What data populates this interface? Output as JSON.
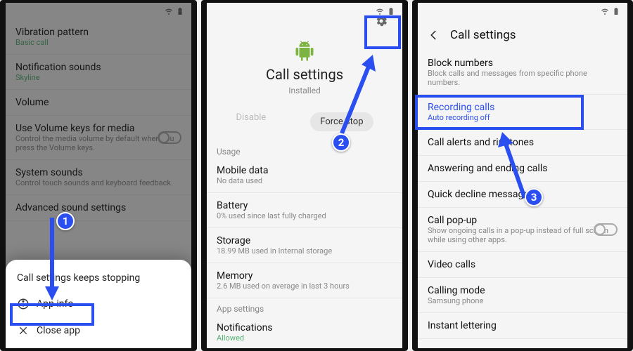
{
  "colors": {
    "highlight": "#2b4ef0"
  },
  "panel1": {
    "items": [
      {
        "title": "Vibration pattern",
        "sub": "Basic call",
        "subClass": "sub"
      },
      {
        "title": "Notification sounds",
        "sub": "Skyline",
        "subClass": "sub"
      },
      {
        "title": "Volume",
        "sub": "",
        "subClass": ""
      },
      {
        "title": "Use Volume keys for media",
        "sub": "Control the media volume by default when you press the Volume keys.",
        "subClass": "sub-gray",
        "toggle": true
      },
      {
        "title": "System sounds",
        "sub": "Control touch sounds and keyboard feedback.",
        "subClass": "sub-gray"
      },
      {
        "title": "Advanced sound settings",
        "sub": "",
        "subClass": ""
      }
    ],
    "dialog": {
      "heading": "Call settings keeps stopping",
      "actions": [
        {
          "icon": "info",
          "label": "App info"
        },
        {
          "icon": "close",
          "label": "Close app"
        }
      ]
    },
    "badge": "1"
  },
  "panel2": {
    "gear_icon": "settings",
    "app_name": "Call settings",
    "installed": "Installed",
    "disable": "Disable",
    "force_stop": "Force stop",
    "section_usage": "Usage",
    "rows": [
      {
        "title": "Mobile data",
        "sub": "No data used"
      },
      {
        "title": "Battery",
        "sub": "0% used since last fully charged"
      },
      {
        "title": "Storage",
        "sub": "18.99 MB used in Internal storage"
      },
      {
        "title": "Memory",
        "sub": "2.6 MB used on average in last 3 hours"
      }
    ],
    "section_appsettings": "App settings",
    "notifications": {
      "title": "Notifications",
      "sub": "Allowed"
    },
    "badge": "2"
  },
  "panel3": {
    "header": "Call settings",
    "rows": [
      {
        "title": "Block numbers",
        "sub": "Block calls and messages from specific phone numbers."
      },
      {
        "title": "Recording calls",
        "sub": "Auto recording off",
        "highlight": true
      },
      {
        "title": "Call alerts and ringtones",
        "sub": ""
      },
      {
        "title": "Answering and ending calls",
        "sub": ""
      },
      {
        "title": "Quick decline messages",
        "sub": ""
      },
      {
        "title": "Call pop-up",
        "sub": "Show ongoing calls in a pop-up instead of full screen while using other apps.",
        "toggle": true
      },
      {
        "title": "Video calls",
        "sub": ""
      },
      {
        "title": "Calling mode",
        "sub": "Samsung phone"
      },
      {
        "title": "Instant lettering",
        "sub": ""
      }
    ],
    "badge": "3"
  }
}
